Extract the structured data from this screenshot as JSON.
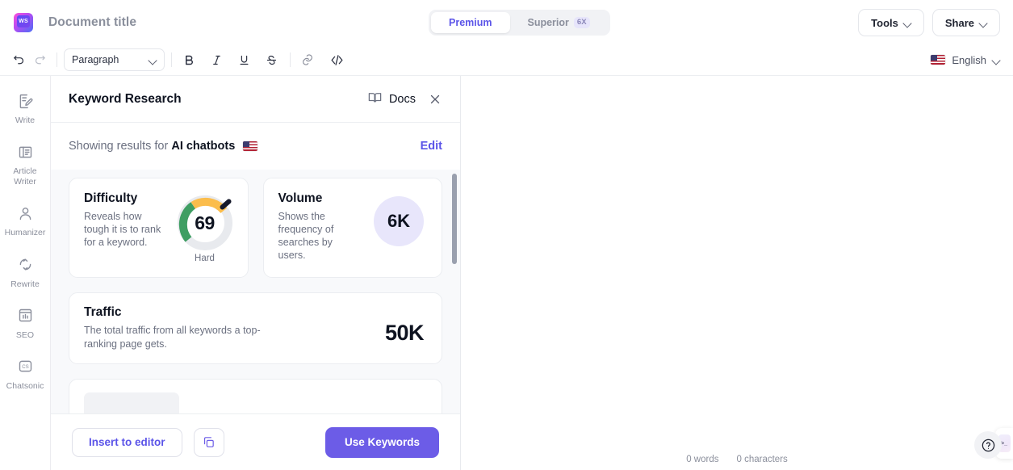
{
  "topbar": {
    "logo_text": "WS",
    "document_title": "Document title",
    "segments": [
      {
        "label": "Premium",
        "badge": "",
        "active": true
      },
      {
        "label": "Superior",
        "badge": "6X",
        "active": false
      }
    ],
    "tools_label": "Tools",
    "share_label": "Share"
  },
  "formatbar": {
    "undo_icon": "undo-icon",
    "redo_icon": "redo-icon",
    "block_style": "Paragraph",
    "bold_label": "B",
    "italic_label": "I",
    "underline_label": "U",
    "strike_label": "S",
    "link_icon": "link-icon",
    "code_icon": "code-icon",
    "language": "English",
    "flag": "us-flag-icon"
  },
  "sidebar": {
    "items": [
      {
        "label": "Write",
        "icon": "write-icon"
      },
      {
        "label": "Article\nWriter",
        "label_line1": "Article",
        "label_line2": "Writer",
        "icon": "article-writer-icon"
      },
      {
        "label": "Humanizer",
        "icon": "humanizer-person-icon"
      },
      {
        "label": "Rewrite",
        "icon": "rewrite-refresh-icon"
      },
      {
        "label": "SEO",
        "icon": "seo-chart-icon"
      },
      {
        "label": "Chatsonic",
        "icon": "chatsonic-cs-icon"
      }
    ]
  },
  "panel": {
    "title": "Keyword Research",
    "docs_label": "Docs",
    "docs_icon": "book-icon",
    "close_icon": "close-icon",
    "results_prefix": "Showing results for",
    "results_keyword": "AI chatbots",
    "results_flag": "us-flag-icon",
    "edit_label": "Edit",
    "cards": [
      {
        "title": "Difficulty",
        "description": "Reveals how tough it is to rank for a keyword.",
        "value": "69",
        "value_label": "Hard",
        "visual": "gauge"
      },
      {
        "title": "Volume",
        "description": "Shows the frequency of searches by users.",
        "value": "6K",
        "visual": "circle"
      }
    ],
    "traffic": {
      "title": "Traffic",
      "description": "The total traffic from all keywords a top-ranking page gets.",
      "value": "50K"
    },
    "footer": {
      "insert_label": "Insert to editor",
      "copy_icon": "copy-icon",
      "use_keywords_label": "Use Keywords"
    }
  },
  "editor": {
    "word_count": "0 words",
    "character_count": "0 characters",
    "help_icon": "help-question-icon"
  },
  "colors": {
    "accent_purple": "#6c5ce7",
    "gauge_green": "#3f9e63",
    "gauge_orange": "#fbbd4c",
    "gauge_gray": "#e8eaee",
    "volume_circle": "#e8e6fb"
  }
}
